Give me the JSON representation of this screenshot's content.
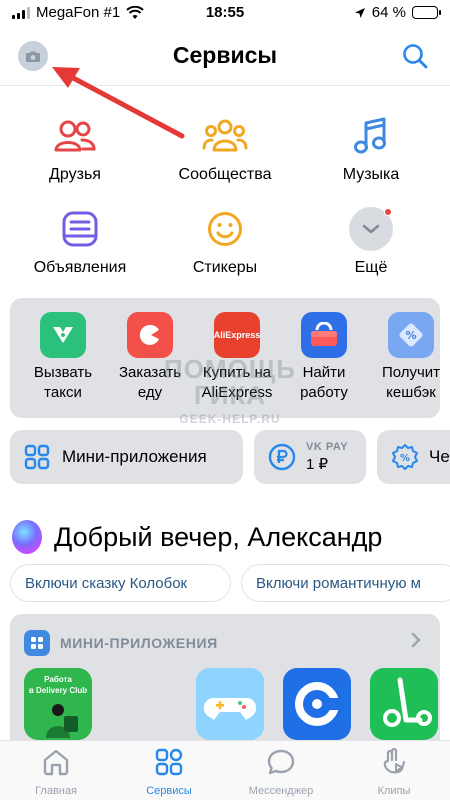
{
  "status_bar": {
    "carrier": "MegaFon #1",
    "time": "18:55",
    "battery_percent": "64 %",
    "battery_level": 0.64
  },
  "header": {
    "title": "Сервисы"
  },
  "services": [
    {
      "label": "Друзья",
      "icon": "friends-icon",
      "color": "#e64646"
    },
    {
      "label": "Сообщества",
      "icon": "communities-icon",
      "color": "#f0a821"
    },
    {
      "label": "Музыка",
      "icon": "music-icon",
      "color": "#3f8ae0"
    },
    {
      "label": "Объявления",
      "icon": "classifieds-icon",
      "color": "#735ce6"
    },
    {
      "label": "Стикеры",
      "icon": "stickers-icon",
      "color": "#f0a821"
    },
    {
      "label": "Ещё",
      "icon": "chevron-down-icon",
      "color": "#818c99"
    }
  ],
  "quick_actions": [
    {
      "label": "Вызвать\nтакси",
      "icon": "taxi-icon",
      "color": "#2bc07c"
    },
    {
      "label": "Заказать\nеду",
      "icon": "food-icon",
      "color": "#f3504a"
    },
    {
      "label": "Купить на\nAliExpress",
      "icon": "aliexpress-icon",
      "color": "#e8422f",
      "brand": "AliExpress"
    },
    {
      "label": "Найти\nработу",
      "icon": "job-icon",
      "color": "#2e6fe8"
    },
    {
      "label": "Получит\nкешбэк",
      "icon": "cashback-icon",
      "color": "#7aa7f2"
    }
  ],
  "pills": {
    "mini_apps_label": "Мини-приложения",
    "vkpay_title": "VK PAY",
    "vkpay_balance": "1 ₽",
    "cut_label": "Че"
  },
  "watermark": {
    "line1": "ПОМОЩЬ",
    "line1b": "ГИКА",
    "line2": "GEEK-HELP.RU"
  },
  "greeting": "Добрый вечер, Александр",
  "chips": [
    "Включи сказку Колобок",
    "Включи романтичную м"
  ],
  "mini_apps": {
    "header": "МИНИ-ПРИЛОЖЕНИЯ",
    "delivery_text": "Работа\nв Delivery Club",
    "apps": [
      "delivery-club-app",
      "games-app",
      "cyberpay-app",
      "scooter-app"
    ]
  },
  "tabs": [
    {
      "label": "Главная",
      "icon": "home-icon",
      "active": false
    },
    {
      "label": "Сервисы",
      "icon": "services-icon",
      "active": true
    },
    {
      "label": "Мессенджер",
      "icon": "messenger-icon",
      "active": false
    },
    {
      "label": "Клипы",
      "icon": "clips-icon",
      "active": false
    }
  ],
  "colors": {
    "accent": "#2688eb",
    "card_bg": "#dfe1e5",
    "arrow": "#e53935"
  }
}
